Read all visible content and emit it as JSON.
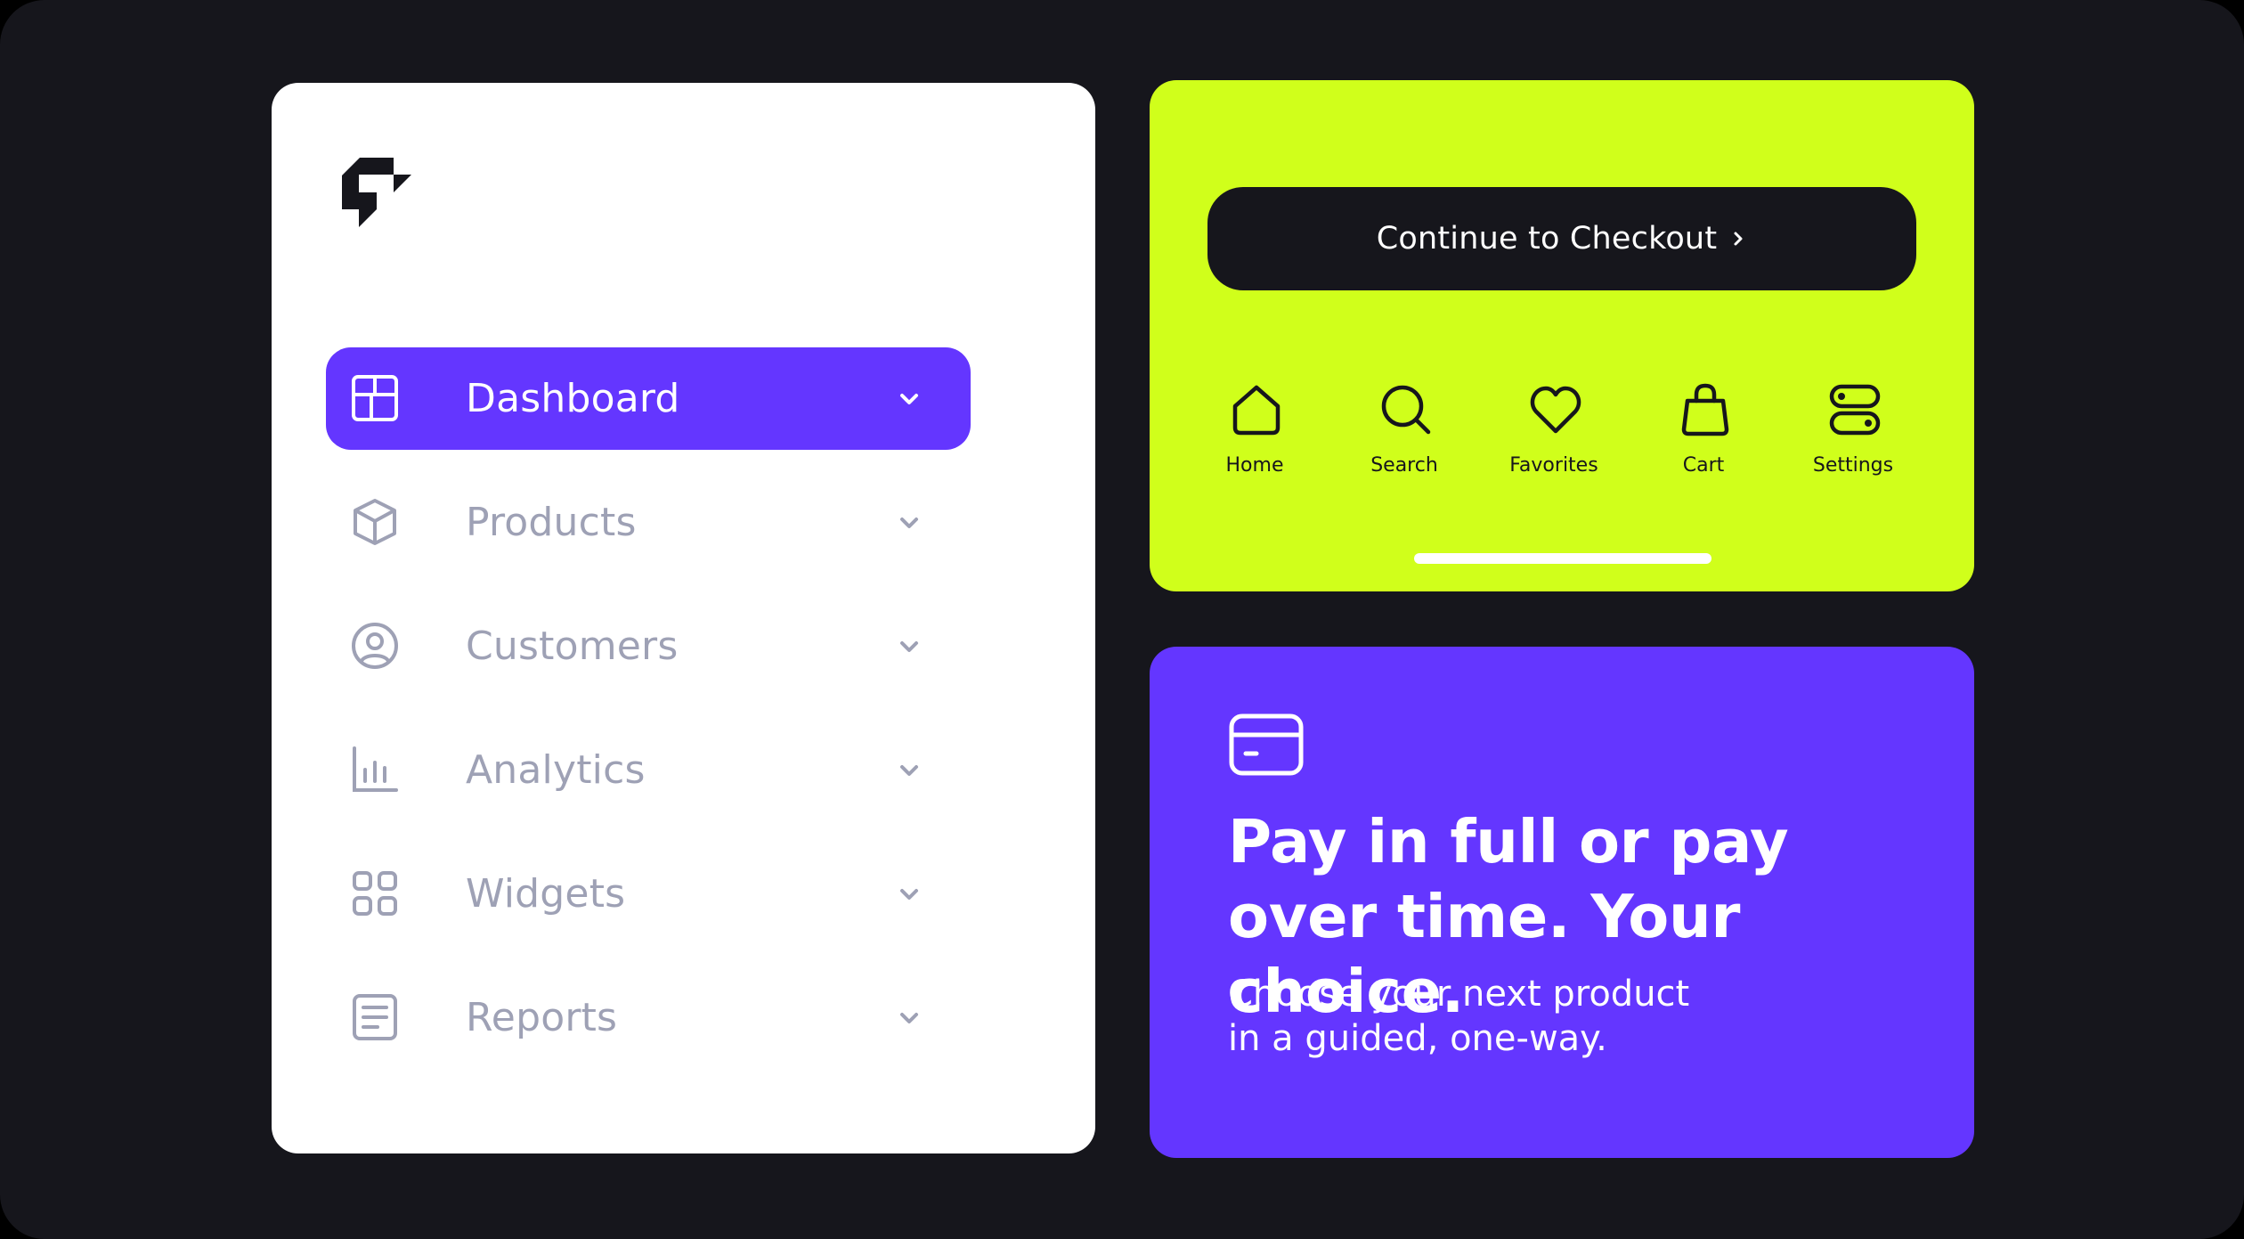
{
  "sidebar": {
    "logo_icon": "brand-logo-icon",
    "items": [
      {
        "label": "Dashboard",
        "icon": "dashboard-icon",
        "active": true
      },
      {
        "label": "Products",
        "icon": "box-icon",
        "active": false
      },
      {
        "label": "Customers",
        "icon": "user-circle-icon",
        "active": false
      },
      {
        "label": "Analytics",
        "icon": "bar-chart-icon",
        "active": false
      },
      {
        "label": "Widgets",
        "icon": "grid-icon",
        "active": false
      },
      {
        "label": "Reports",
        "icon": "document-icon",
        "active": false
      }
    ]
  },
  "checkout": {
    "button_label": "Continue to Checkout",
    "tabs": [
      {
        "label": "Home",
        "icon": "home-icon"
      },
      {
        "label": "Search",
        "icon": "search-icon"
      },
      {
        "label": "Favorites",
        "icon": "heart-icon"
      },
      {
        "label": "Cart",
        "icon": "shopping-bag-icon"
      },
      {
        "label": "Settings",
        "icon": "toggles-icon"
      }
    ]
  },
  "promo": {
    "icon": "credit-card-icon",
    "headline": "Pay in full or pay over time. Your choice.",
    "subtext_line1": "Choose your next product",
    "subtext_line2": "in a guided, one-way."
  },
  "colors": {
    "background": "#16161c",
    "accent_purple": "#6436ff",
    "accent_lime": "#d0ff1b",
    "inactive_gray": "#9ea1b5",
    "card_white": "#ffffff"
  }
}
